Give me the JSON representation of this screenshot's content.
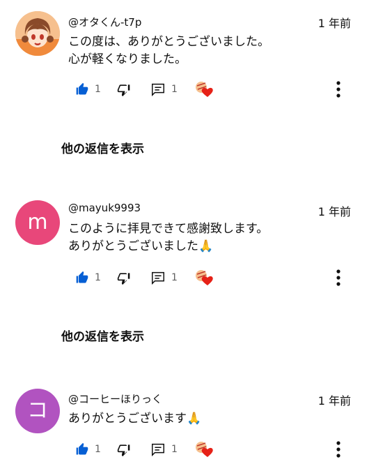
{
  "comments": [
    {
      "handle": "@オタくん-t7p",
      "time": "1 年前",
      "text": "この度は、ありがとうございました。\n心が軽くなりました。",
      "likes": "1",
      "replies": "1",
      "avatar_type": "image",
      "avatar_color": "#f2a35e",
      "show_replies": "他の返信を表示"
    },
    {
      "handle": "@mayuk9993",
      "time": "1 年前",
      "text": "このように拝見できて感謝致します。\nありがとうございました🙏",
      "likes": "1",
      "replies": "1",
      "avatar_type": "letter",
      "avatar_letter": "m",
      "avatar_color": "#e8477a",
      "show_replies": "他の返信を表示"
    },
    {
      "handle": "@コーヒーほりっく",
      "time": "1 年前",
      "text": "ありがとうございます🙏",
      "likes": "1",
      "replies": "1",
      "avatar_type": "letter",
      "avatar_letter": "コ",
      "avatar_color": "#b153c0"
    }
  ],
  "colors": {
    "like_blue": "#065fd4",
    "heart_red": "#e62117",
    "icon_gray": "#606060"
  },
  "icons": {
    "like": "thumbs-up-icon",
    "dislike": "thumbs-down-icon",
    "reply": "comment-icon",
    "creator_heart": "creator-heart-icon",
    "more": "more-vert-icon"
  }
}
